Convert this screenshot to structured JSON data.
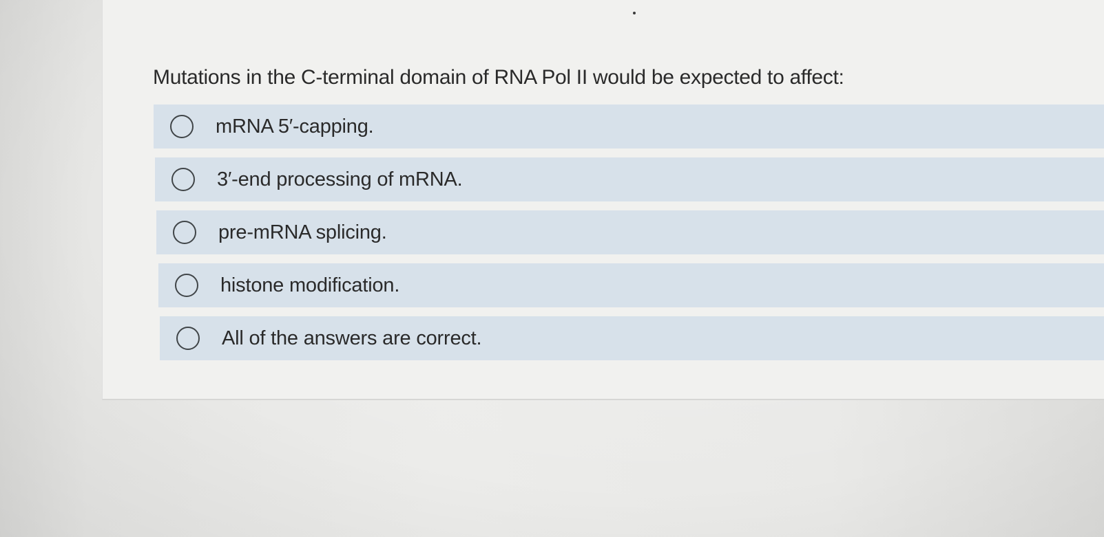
{
  "question": {
    "text": "Mutations in the C-terminal domain of RNA Pol II would be expected to affect:"
  },
  "answers": [
    {
      "label": "mRNA 5′-capping.",
      "selected": false
    },
    {
      "label": "3′-end processing of mRNA.",
      "selected": false
    },
    {
      "label": "pre-mRNA splicing.",
      "selected": false
    },
    {
      "label": "histone modification.",
      "selected": false
    },
    {
      "label": "All of the answers are correct.",
      "selected": false
    }
  ],
  "colors": {
    "page_background": "#e9e9e7",
    "card_background": "#f1f1ef",
    "answer_background": "#d7e1ea",
    "radio_border": "#404548",
    "text": "#2a2a2a"
  },
  "icons": {
    "radio": "radio-unselected-icon"
  }
}
